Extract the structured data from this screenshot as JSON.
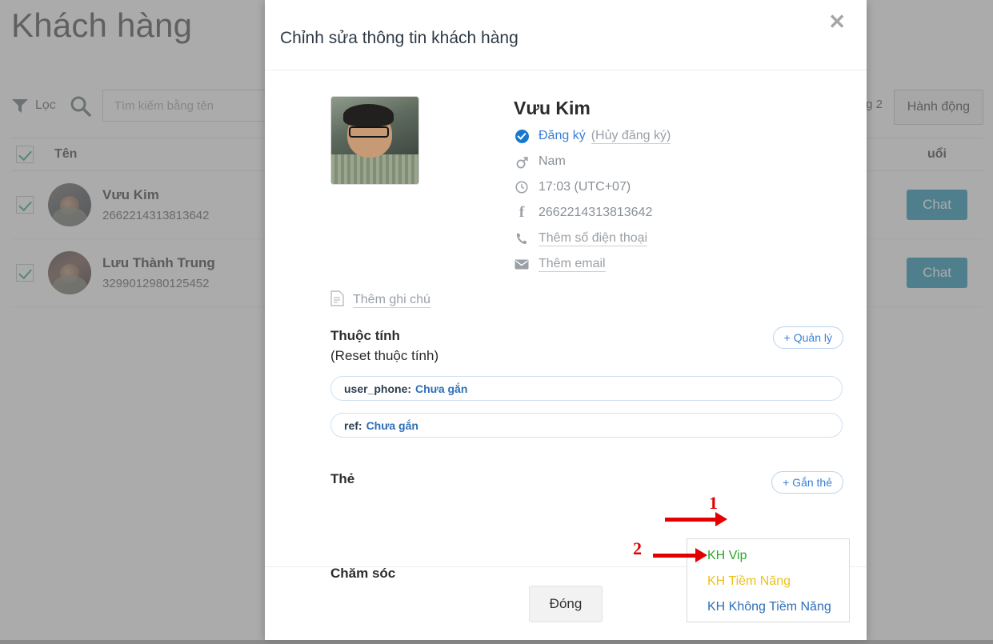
{
  "background": {
    "page_title": "Khách hàng",
    "filter_label": "Lọc",
    "filter_icon": "funnel-icon",
    "search_icon": "search-icon",
    "search_placeholder": "Tìm kiếm bằng tên",
    "search_value": "",
    "pager_text": "g 2",
    "action_button": "Hành động",
    "columns": {
      "name": "Tên",
      "last": "uổi"
    },
    "rows": [
      {
        "name": "Vưu Kim",
        "id": "2662214313813642",
        "chat_label": "Chat",
        "checked": true
      },
      {
        "name": "Lưu Thành Trung",
        "id": "3299012980125452",
        "chat_label": "Chat",
        "checked": true
      }
    ],
    "chat_color": "#0e8cb0"
  },
  "modal": {
    "title": "Chỉnh sửa thông tin khách hàng",
    "close_icon": "close-icon",
    "profile": {
      "avatar_alt": "profile-photo",
      "name": "Vưu Kim",
      "rows": [
        {
          "icon": "check-circle-icon",
          "text": "Đăng ký",
          "link": "(Hủy đăng ký)"
        },
        {
          "icon": "male-gender-icon",
          "text": "Nam"
        },
        {
          "icon": "clock-icon",
          "text": "17:03 (UTC+07)"
        },
        {
          "icon": "facebook-icon",
          "text": "2662214313813642"
        },
        {
          "icon": "phone-icon",
          "text": "Thêm số điện thoại"
        },
        {
          "icon": "envelope-icon",
          "text": "Thêm email"
        }
      ]
    },
    "note": {
      "icon": "note-icon",
      "label": "Thêm ghi chú"
    },
    "attributes": {
      "label": "Thuộc tính",
      "reset_label": "(Reset thuộc tính)",
      "manage_button": "+ Quản lý",
      "items": [
        {
          "key": "user_phone:",
          "value": "Chưa gắn"
        },
        {
          "key": "ref:",
          "value": "Chưa gắn"
        }
      ]
    },
    "tag": {
      "label": "Thẻ",
      "add_button": "+ Gắn thẻ",
      "options": [
        {
          "label": "KH Vip",
          "color": "#2aa52a"
        },
        {
          "label": "KH Tiềm Năng",
          "color": "#ecc21a"
        },
        {
          "label": "KH Không Tiềm Năng",
          "color": "#2e6fb7"
        }
      ]
    },
    "care_label": "Chăm sóc",
    "annotations": [
      {
        "number": "1",
        "color": "#e00000"
      },
      {
        "number": "2",
        "color": "#e00000"
      }
    ],
    "footer": {
      "close_label": "Đóng"
    }
  }
}
